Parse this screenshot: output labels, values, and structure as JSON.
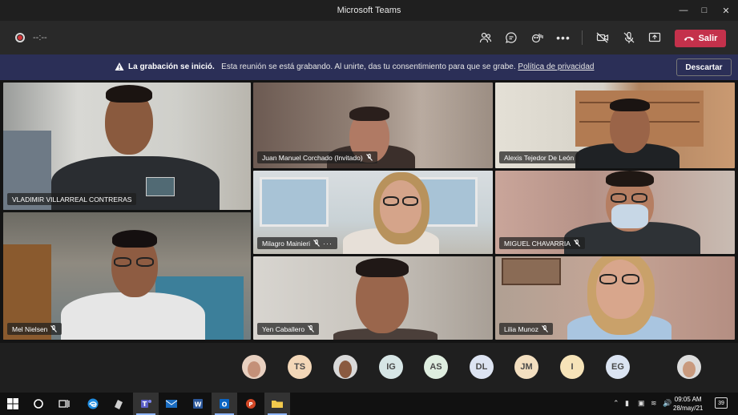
{
  "window": {
    "title": "Microsoft Teams"
  },
  "toolbar": {
    "timer": "--:--",
    "leave_label": "Salir"
  },
  "banner": {
    "title": "La grabación se inició.",
    "message": "Esta reunión se está grabando. Al unirte, das tu consentimiento para que se grabe.",
    "link": "Política de privacidad",
    "dismiss_label": "Descartar"
  },
  "participants": {
    "p1": "VLADIMIR VILLARREAL CONTRERAS",
    "p2": "Juan Manuel Corchado (Invitado)",
    "p3": "Alexis Tejedor De León",
    "p4": "Milagro Mainieri",
    "p5": "MIGUEL CHAVARRIA",
    "p6": "Mel Nielsen",
    "p7": "Yen Caballero",
    "p8": "Lilia Munoz"
  },
  "tray": {
    "initials": [
      "TS",
      "IG",
      "AS",
      "DL",
      "JM",
      "I",
      "EG"
    ]
  },
  "taskbar": {
    "time": "09:05 AM",
    "date": "28/may/21",
    "notifications": "39"
  },
  "colors": {
    "leave": "#c4314b",
    "banner": "#2b2f57",
    "background": "#1f1f1f"
  }
}
